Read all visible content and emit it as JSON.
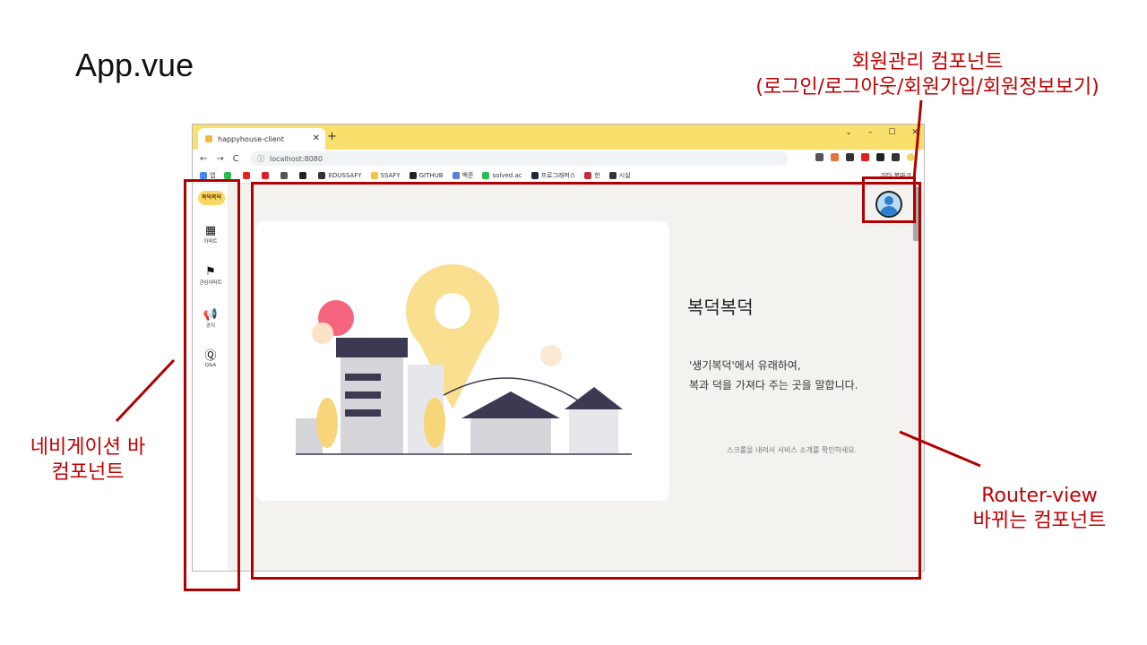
{
  "slide": {
    "title": "App.vue",
    "annotations": {
      "user_component_line1": "회원관리 컴포넌트",
      "user_component_line2": "(로그인/로그아웃/회원가입/회원정보보기)",
      "nav_component_line1": "네비게이션 바",
      "nav_component_line2": "컴포넌트",
      "router_view_line1": "Router-view",
      "router_view_line2": "바뀌는 컴포넌트"
    },
    "annotation_color": "#c00000"
  },
  "browser": {
    "tab_title": "happyhouse-client",
    "new_tab": "+",
    "tab_close": "✕",
    "window_controls": [
      "⌄",
      "–",
      "☐",
      "✕"
    ],
    "nav": {
      "back": "←",
      "forward": "→",
      "reload": "C"
    },
    "url_info_icon": "ⓘ",
    "url": "localhost:8080",
    "bookmarks": [
      {
        "label": "앱",
        "color": "#4285f4"
      },
      {
        "label": "",
        "color": "#2bbc50"
      },
      {
        "label": "",
        "color": "#e62117"
      },
      {
        "label": "",
        "color": "#d81f26"
      },
      {
        "label": "",
        "color": "#555555"
      },
      {
        "label": "",
        "color": "#222222"
      },
      {
        "label": "EDUSSAFY",
        "color": "#333333"
      },
      {
        "label": "SSAFY",
        "color": "#f4c542"
      },
      {
        "label": "GITHUB",
        "color": "#222222"
      },
      {
        "label": "백준",
        "color": "#5b7fd6"
      },
      {
        "label": "solved.ac",
        "color": "#2bbc50"
      },
      {
        "label": "프로그래머스",
        "color": "#1e2a3a"
      },
      {
        "label": "한",
        "color": "#c4303a"
      },
      {
        "label": "시실",
        "color": "#333333"
      }
    ],
    "other_bookmarks": "기타 북마크",
    "accent_color": "#f9df6b"
  },
  "app": {
    "logo": "복덕복덕",
    "nav_items": [
      {
        "icon": "apartment-icon",
        "glyph": "▦",
        "label": "아파트"
      },
      {
        "icon": "flag-icon",
        "glyph": "⚑",
        "label": "관심아파트"
      },
      {
        "icon": "megaphone-icon",
        "glyph": "📢",
        "label": "공지"
      },
      {
        "icon": "qna-icon",
        "glyph": "Ⓠ",
        "label": "Q&A"
      }
    ],
    "hero": {
      "title": "복덕복덕",
      "desc_line1": "'생기복덕'에서 유래하여,",
      "desc_line2": "복과 덕을 가져다 주는 곳을 말합니다.",
      "hint": "스크롤을 내려서 서비스 소개를 확인하세요."
    },
    "user_icon": "user-avatar-icon",
    "background": "#f4f2ee"
  }
}
